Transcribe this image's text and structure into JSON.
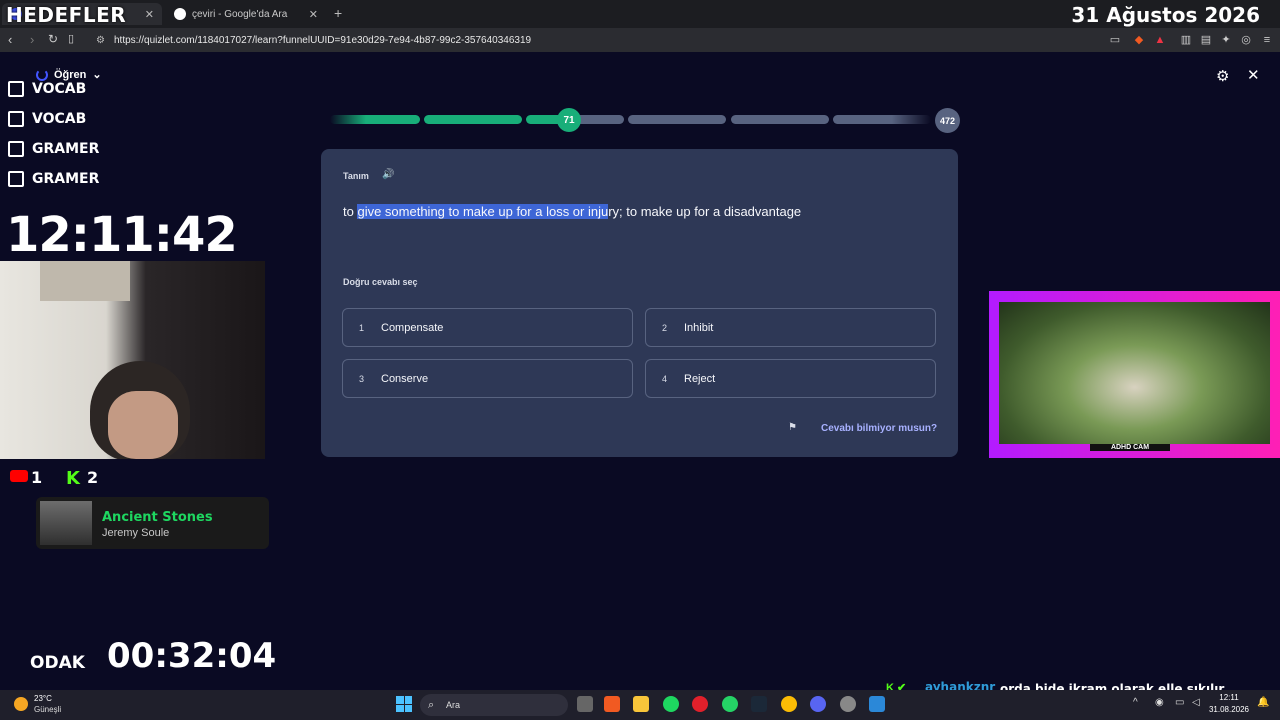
{
  "overlay": {
    "goals_title": "HEDEFLER",
    "date": "31 Ağustos 2026",
    "goals": [
      "VOCAB",
      "VOCAB",
      "GRAMER",
      "GRAMER"
    ],
    "clock": "12:11:42",
    "youtube_count": "1",
    "kick_count": "2",
    "music": {
      "title": "Ancient Stones",
      "artist": "Jeremy Soule"
    },
    "focus_label": "ODAK",
    "focus_timer": "00:32:04",
    "adhd_cam_label": "ADHD CAM"
  },
  "browser": {
    "tabs": [
      {
        "label": "",
        "favicon_color": "#4255ff"
      },
      {
        "label": "çeviri - Google'da Ara",
        "favicon_color": "#ffffff"
      }
    ],
    "url": "https://quizlet.com/1184017027/learn?funnelUUID=91e30d29-7e94-4b87-99c2-357640346319"
  },
  "quizlet": {
    "mode": "Öğren",
    "progress_current": "71",
    "progress_total": "472",
    "term_label": "Tanım",
    "definition_pre": "to ",
    "definition_highlight": "give something to make up for a loss or inju",
    "definition_post": "ry; to make up for a disadvantage",
    "choose_label": "Doğru cevabı seç",
    "options": [
      {
        "num": "1",
        "text": "Compensate"
      },
      {
        "num": "2",
        "text": "Inhibit"
      },
      {
        "num": "3",
        "text": "Conserve"
      },
      {
        "num": "4",
        "text": "Reject"
      }
    ],
    "dont_know": "Cevabı bilmiyor musun?"
  },
  "chat": {
    "user": "ayhankznr",
    "message": "orda bide ikram olarak elle sıkılır verilir pisirmeden"
  },
  "taskbar": {
    "weather_temp": "23°C",
    "weather_cond": "Güneşli",
    "search_placeholder": "Ara",
    "time": "12:11",
    "date": "31.08.2026"
  },
  "colors": {
    "accent": "#18ae79",
    "card": "#2e3856",
    "highlight": "#3e66d6"
  }
}
